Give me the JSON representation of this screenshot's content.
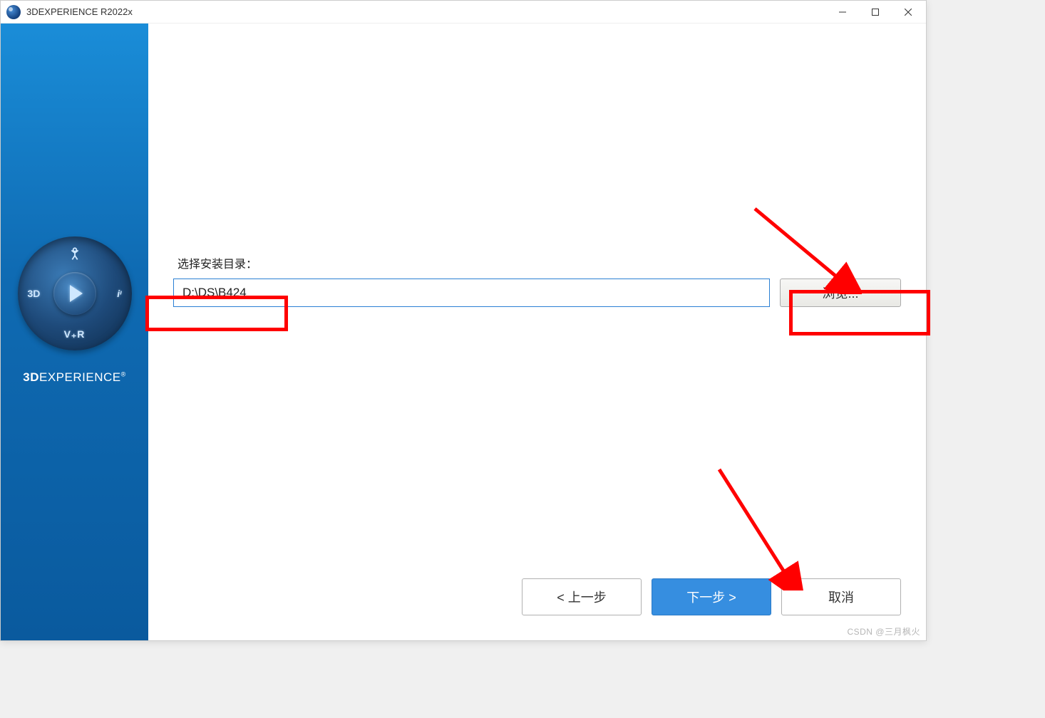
{
  "window": {
    "title": "3DEXPERIENCE R2022x"
  },
  "sidebar": {
    "compass": {
      "north_icon": "social-icon",
      "south_label": "V₊R",
      "west_label": "3D",
      "east_label": "iᶦ"
    },
    "brand_bold": "3D",
    "brand_light": "EXPERIENCE",
    "brand_mark": "®"
  },
  "main": {
    "label": "选择安装目录：",
    "path_value": "D:\\DS\\B424",
    "browse_label": "浏览..."
  },
  "footer": {
    "back_label": "< 上一步",
    "next_label": "下一步 >",
    "cancel_label": "取消"
  },
  "watermark": "CSDN @三月枫火",
  "colors": {
    "primary": "#368ee0",
    "accent_red": "#ff0000"
  }
}
